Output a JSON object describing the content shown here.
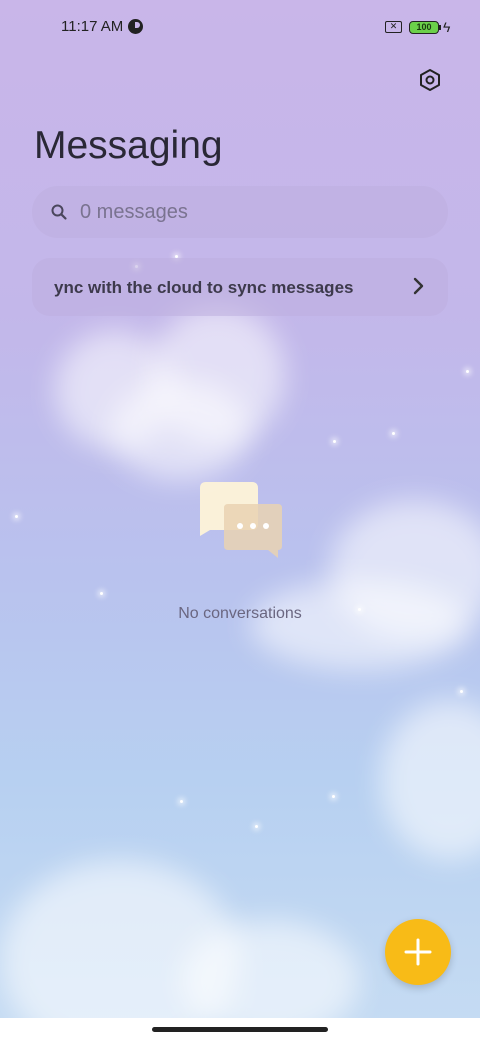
{
  "status_bar": {
    "time": "11:17 AM",
    "battery_level": "100",
    "icons": [
      "dnd-icon",
      "sim-x-icon",
      "battery-icon",
      "charging-bolt-icon"
    ]
  },
  "header": {
    "title": "Messaging",
    "settings_icon": "settings-hexagon-icon"
  },
  "search": {
    "placeholder": "0 messages",
    "icon": "search-icon"
  },
  "sync_banner": {
    "text": "ync with the cloud to sync messages",
    "icon": "chevron-right-icon"
  },
  "empty_state": {
    "icon": "chat-bubbles-icon",
    "text": "No conversations"
  },
  "fab": {
    "icon": "plus-icon",
    "color": "#f8bb17"
  },
  "colors": {
    "accent": "#f8bb17",
    "title": "#2a2836"
  }
}
